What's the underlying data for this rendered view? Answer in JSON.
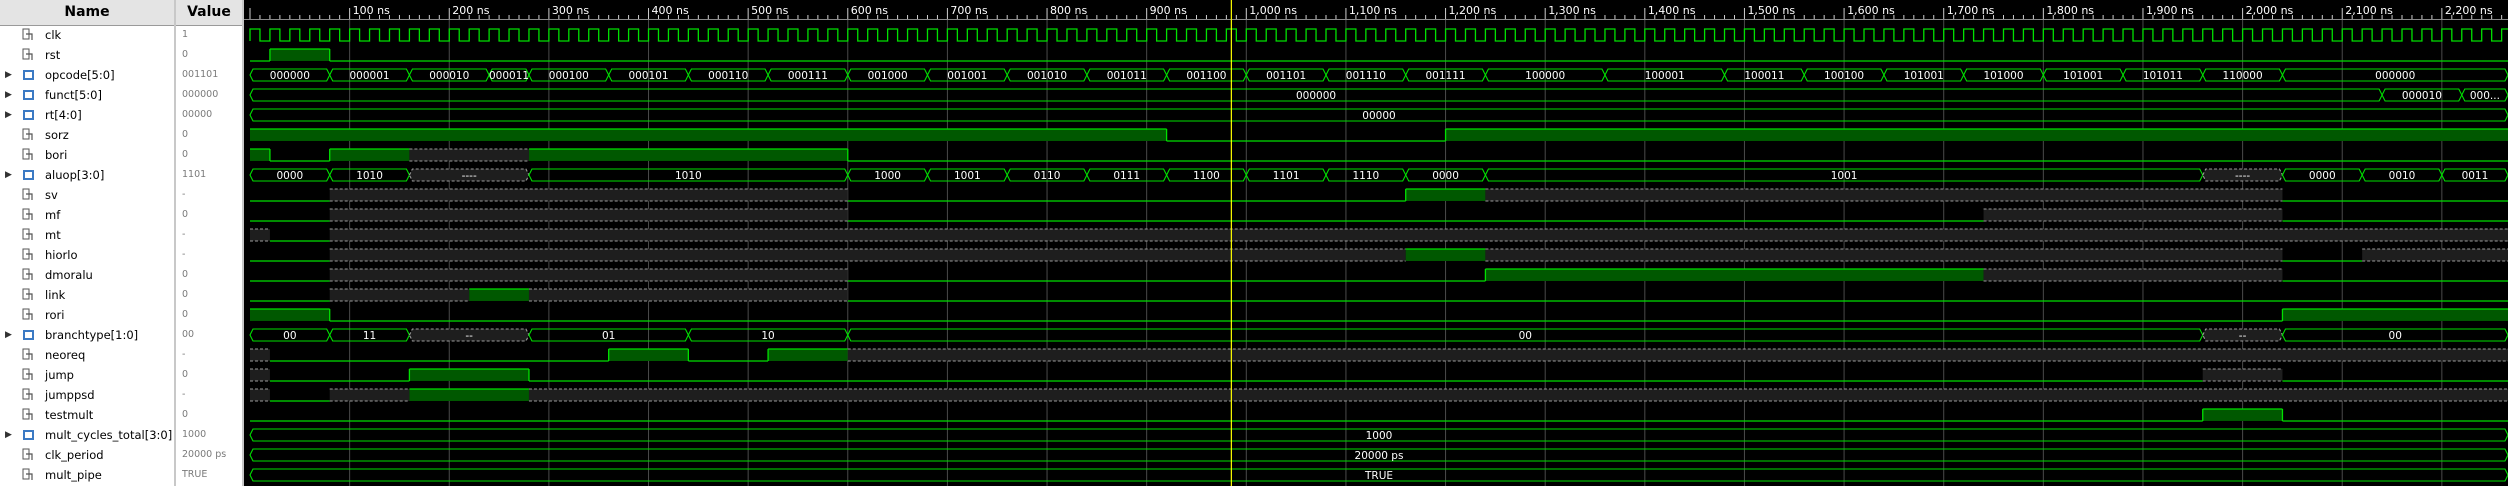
{
  "headers": {
    "name": "Name",
    "value": "Value"
  },
  "time_axis": {
    "labels": [
      "100 ns",
      "200 ns",
      "300 ns",
      "400 ns",
      "500 ns",
      "600 ns",
      "700 ns",
      "800 ns",
      "900 ns",
      "1,000 ns",
      "1,100 ns",
      "1,200 ns",
      "1,300 ns",
      "1,400 ns",
      "1,500 ns",
      "1,600 ns",
      "1,700 ns",
      "1,800 ns",
      "1,900 ns",
      "2,000 ns",
      "2,100 ns",
      "2,200 ns"
    ],
    "cursor_ns": 985
  },
  "signals": [
    {
      "name": "clk",
      "value": "1",
      "kind": "clock"
    },
    {
      "name": "rst",
      "value": "0",
      "kind": "bit",
      "segs": [
        [
          0,
          20,
          "0"
        ],
        [
          20,
          80,
          "1"
        ],
        [
          80,
          2300,
          "0"
        ]
      ]
    },
    {
      "name": "opcode[5:0]",
      "value": "001101",
      "kind": "bus",
      "expandable": true,
      "segs": [
        [
          0,
          80,
          "000000"
        ],
        [
          80,
          160,
          "000001"
        ],
        [
          160,
          240,
          "000010"
        ],
        [
          240,
          280,
          "000011"
        ],
        [
          280,
          360,
          "000100"
        ],
        [
          360,
          440,
          "000101"
        ],
        [
          440,
          520,
          "000110"
        ],
        [
          520,
          600,
          "000111"
        ],
        [
          600,
          680,
          "001000"
        ],
        [
          680,
          760,
          "001001"
        ],
        [
          760,
          840,
          "001010"
        ],
        [
          840,
          920,
          "001011"
        ],
        [
          920,
          1000,
          "001100"
        ],
        [
          1000,
          1080,
          "001101"
        ],
        [
          1080,
          1160,
          "001110"
        ],
        [
          1160,
          1240,
          "001111"
        ],
        [
          1240,
          1360,
          "100000"
        ],
        [
          1360,
          1480,
          "100001"
        ],
        [
          1480,
          1560,
          "100011"
        ],
        [
          1560,
          1640,
          "100100"
        ],
        [
          1640,
          1720,
          "101001"
        ],
        [
          1720,
          1800,
          "101000"
        ],
        [
          1800,
          1880,
          "101001"
        ],
        [
          1880,
          1960,
          "101011"
        ],
        [
          1960,
          2040,
          "110000"
        ],
        [
          2040,
          2300,
          "000000"
        ]
      ]
    },
    {
      "name": "funct[5:0]",
      "value": "000000",
      "kind": "bus",
      "expandable": true,
      "segs": [
        [
          0,
          2140,
          "000000"
        ],
        [
          2140,
          2220,
          "000010"
        ],
        [
          2220,
          2300,
          "000..."
        ]
      ]
    },
    {
      "name": "rt[4:0]",
      "value": "00000",
      "kind": "bus",
      "expandable": true,
      "segs": [
        [
          0,
          2300,
          "00000"
        ]
      ]
    },
    {
      "name": "sorz",
      "value": "0",
      "kind": "bit",
      "segs": [
        [
          0,
          920,
          "1"
        ],
        [
          920,
          1200,
          "0"
        ],
        [
          1200,
          2300,
          "1"
        ]
      ]
    },
    {
      "name": "bori",
      "value": "0",
      "kind": "bit",
      "segs": [
        [
          0,
          20,
          "1"
        ],
        [
          20,
          80,
          "0"
        ],
        [
          80,
          160,
          "1"
        ],
        [
          160,
          280,
          "X"
        ],
        [
          280,
          600,
          "1"
        ],
        [
          600,
          2300,
          "0"
        ]
      ]
    },
    {
      "name": "aluop[3:0]",
      "value": "1101",
      "kind": "bus",
      "expandable": true,
      "segs": [
        [
          0,
          80,
          "0000"
        ],
        [
          80,
          160,
          "1010"
        ],
        [
          160,
          280,
          "----"
        ],
        [
          280,
          600,
          "1010"
        ],
        [
          600,
          680,
          "1000"
        ],
        [
          680,
          760,
          "1001"
        ],
        [
          760,
          840,
          "0110"
        ],
        [
          840,
          920,
          "0111"
        ],
        [
          920,
          1000,
          "1100"
        ],
        [
          1000,
          1080,
          "1101"
        ],
        [
          1080,
          1160,
          "1110"
        ],
        [
          1160,
          1240,
          "0000"
        ],
        [
          1240,
          1960,
          "1001"
        ],
        [
          1960,
          2040,
          "----"
        ],
        [
          2040,
          2120,
          "0000"
        ],
        [
          2120,
          2200,
          "0010"
        ],
        [
          2200,
          2300,
          "0011"
        ]
      ]
    },
    {
      "name": "sv",
      "value": "-",
      "kind": "bit",
      "segs": [
        [
          0,
          80,
          "0"
        ],
        [
          80,
          600,
          "X"
        ],
        [
          600,
          1160,
          "0"
        ],
        [
          1160,
          1240,
          "1"
        ],
        [
          1240,
          2040,
          "X"
        ],
        [
          2040,
          2300,
          "0"
        ]
      ]
    },
    {
      "name": "mf",
      "value": "0",
      "kind": "bit",
      "segs": [
        [
          0,
          80,
          "0"
        ],
        [
          80,
          600,
          "X"
        ],
        [
          600,
          1740,
          "0"
        ],
        [
          1740,
          2040,
          "X"
        ],
        [
          2040,
          2300,
          "0"
        ]
      ]
    },
    {
      "name": "mt",
      "value": "-",
      "kind": "bit",
      "segs": [
        [
          0,
          20,
          "X"
        ],
        [
          20,
          80,
          "0"
        ],
        [
          80,
          2300,
          "X"
        ]
      ]
    },
    {
      "name": "hiorlo",
      "value": "-",
      "kind": "bit",
      "segs": [
        [
          0,
          80,
          "0"
        ],
        [
          80,
          1160,
          "X"
        ],
        [
          1160,
          1240,
          "1"
        ],
        [
          1240,
          2040,
          "X"
        ],
        [
          2040,
          2120,
          "0"
        ],
        [
          2120,
          2300,
          "X"
        ]
      ]
    },
    {
      "name": "dmoralu",
      "value": "0",
      "kind": "bit",
      "segs": [
        [
          0,
          80,
          "0"
        ],
        [
          80,
          600,
          "X"
        ],
        [
          600,
          1240,
          "0"
        ],
        [
          1240,
          1740,
          "1"
        ],
        [
          1740,
          2040,
          "X"
        ],
        [
          2040,
          2300,
          "0"
        ]
      ]
    },
    {
      "name": "link",
      "value": "0",
      "kind": "bit",
      "segs": [
        [
          0,
          80,
          "0"
        ],
        [
          80,
          220,
          "X"
        ],
        [
          220,
          280,
          "1"
        ],
        [
          280,
          600,
          "X"
        ],
        [
          600,
          2300,
          "0"
        ]
      ]
    },
    {
      "name": "rori",
      "value": "0",
      "kind": "bit",
      "segs": [
        [
          0,
          80,
          "1"
        ],
        [
          80,
          2040,
          "0"
        ],
        [
          2040,
          2300,
          "1"
        ]
      ]
    },
    {
      "name": "branchtype[1:0]",
      "value": "00",
      "kind": "bus",
      "expandable": true,
      "segs": [
        [
          0,
          80,
          "00"
        ],
        [
          80,
          160,
          "11"
        ],
        [
          160,
          280,
          "--"
        ],
        [
          280,
          440,
          "01"
        ],
        [
          440,
          600,
          "10"
        ],
        [
          600,
          1960,
          "00"
        ],
        [
          1960,
          2040,
          "--"
        ],
        [
          2040,
          2300,
          "00"
        ]
      ]
    },
    {
      "name": "neoreq",
      "value": "-",
      "kind": "bit",
      "segs": [
        [
          0,
          20,
          "X"
        ],
        [
          20,
          360,
          "0"
        ],
        [
          360,
          440,
          "1"
        ],
        [
          440,
          520,
          "0"
        ],
        [
          520,
          600,
          "1"
        ],
        [
          600,
          2300,
          "X"
        ]
      ]
    },
    {
      "name": "jump",
      "value": "0",
      "kind": "bit",
      "segs": [
        [
          0,
          20,
          "X"
        ],
        [
          20,
          160,
          "0"
        ],
        [
          160,
          280,
          "1"
        ],
        [
          280,
          1960,
          "0"
        ],
        [
          1960,
          2040,
          "X"
        ],
        [
          2040,
          2300,
          "0"
        ]
      ]
    },
    {
      "name": "jumppsd",
      "value": "-",
      "kind": "bit",
      "segs": [
        [
          0,
          20,
          "X"
        ],
        [
          20,
          80,
          "0"
        ],
        [
          80,
          160,
          "X"
        ],
        [
          160,
          280,
          "1"
        ],
        [
          280,
          2300,
          "X"
        ]
      ]
    },
    {
      "name": "testmult",
      "value": "0",
      "kind": "bit",
      "segs": [
        [
          0,
          1960,
          "0"
        ],
        [
          1960,
          2040,
          "1"
        ],
        [
          2040,
          2300,
          "0"
        ]
      ]
    },
    {
      "name": "mult_cycles_total[3:0]",
      "value": "1000",
      "kind": "bus",
      "expandable": true,
      "segs": [
        [
          0,
          2300,
          "1000"
        ]
      ]
    },
    {
      "name": "clk_period",
      "value": "20000 ps",
      "kind": "bus",
      "segs": [
        [
          0,
          2300,
          "20000 ps"
        ]
      ]
    },
    {
      "name": "mult_pipe",
      "value": "TRUE",
      "kind": "bus",
      "segs": [
        [
          0,
          2300,
          "TRUE"
        ]
      ]
    }
  ],
  "colors": {
    "wave": "#00e000",
    "fill": "#005800",
    "unknown": "#9a9a9a",
    "text": "#ffffff",
    "cursor": "#ffff00",
    "grid": "#4a4a4a",
    "bus_icon": "#3b7ac4"
  }
}
